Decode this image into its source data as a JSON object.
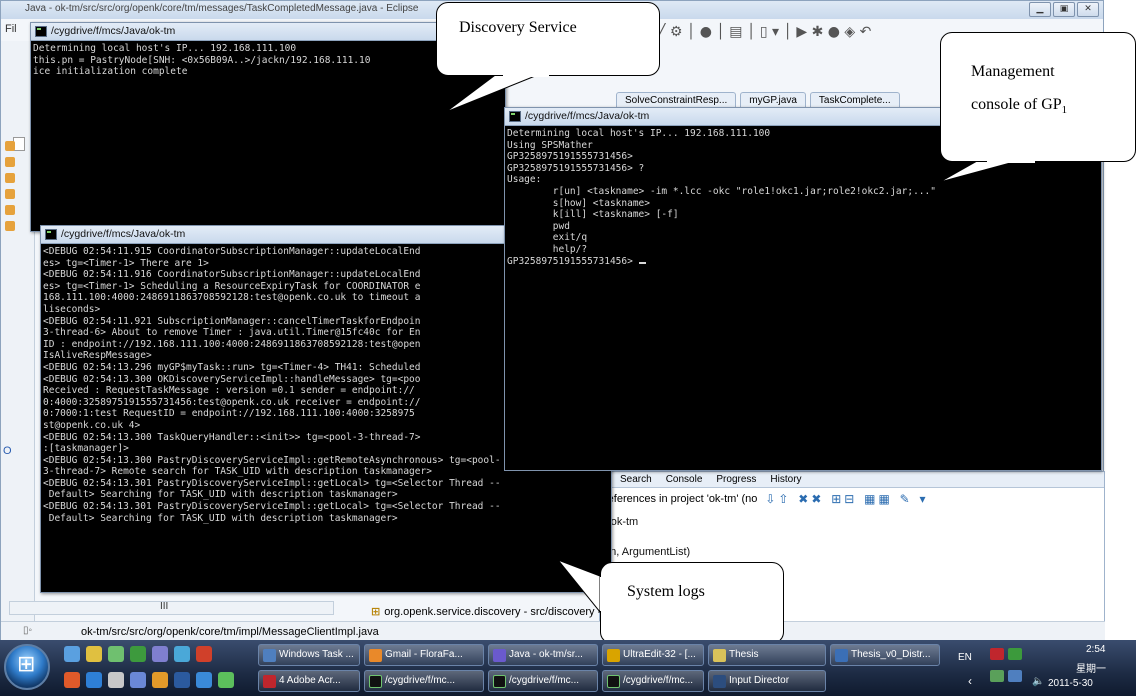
{
  "eclipse": {
    "title": "Java - ok-tm/src/src/org/openk/core/tm/messages/TaskCompletedMessage.java - Eclipse",
    "menu_file": "Fil",
    "editor_tabs": [
      "SolveConstraintResp...",
      "myGP.java",
      "TaskComplete..."
    ],
    "toolbar_glyphs": "╱ ⚙ │ ● │ ▤ │ ▯ ▾ │ ▶ ✱ ● ◈ ↶",
    "left_tab_o": "O",
    "left_hscroll_label": "III",
    "search_tabs": [
      "Search",
      "Console",
      "Progress",
      "History"
    ],
    "search_result_text": "references in project 'ok-tm' (no",
    "search_rows": [
      "- ok-tm",
      "an, ArgumentList)"
    ],
    "tree_items": [
      "org.openk.service.discovery - src/discovery - o"
    ],
    "status_path": "ok-tm/src/src/org/openk/core/tm/impl/MessageClientImpl.java",
    "status_icon": "▯◦"
  },
  "consoles": {
    "discovery": {
      "title": "/cygdrive/f/mcs/Java/ok-tm",
      "text": "Determining local host's IP... 192.168.111.100\nthis.pn = PastryNode[SNH: <0x56B09A..>/jackn/192.168.111.10\nice initialization complete"
    },
    "management": {
      "title": "/cygdrive/f/mcs/Java/ok-tm",
      "text": "Determining local host's IP... 192.168.111.100\nUsing SPSMather\nGP3258975191555731456>\nGP3258975191555731456> ?\nUsage:\n        r[un] <taskname> -im *.lcc -okc \"role1!okc1.jar;role2!okc2.jar;...\"\n        s[how] <taskname>\n        k[ill] <taskname> [-f]\n        pwd\n        exit/q\n        help/?",
      "prompt": "GP3258975191555731456> "
    },
    "logs": {
      "title": "/cygdrive/f/mcs/Java/ok-tm",
      "text": "<DEBUG 02:54:11.915 CoordinatorSubscriptionManager::updateLocalEnd\nes> tg=<Timer-1> There are 1>\n<DEBUG 02:54:11.916 CoordinatorSubscriptionManager::updateLocalEnd\nes> tg=<Timer-1> Scheduling a ResourceExpiryTask for COORDINATOR e\n168.111.100:4000:2486911863708592128:test@openk.co.uk to timeout a\nliseconds>\n<DEBUG 02:54:11.921 SubscriptionManager::cancelTimerTaskforEndpoin\n3-thread-6> About to remove Timer : java.util.Timer@15fc40c for En\nID : endpoint://192.168.111.100:4000:2486911863708592128:test@open\nIsAliveRespMessage>\n<DEBUG 02:54:13.296 myGP$myTask::run> tg=<Timer-4> TH41: Scheduled\n<DEBUG 02:54:13.300 OKDiscoveryServiceImpl::handleMessage> tg=<poo\nReceived : RequestTaskMessage : version =0.1 sender = endpoint://\n0:4000:3258975191555731456:test@openk.co.uk receiver = endpoint://\n0:7000:1:test RequestID = endpoint://192.168.111.100:4000:3258975\nst@openk.co.uk 4>\n<DEBUG 02:54:13.300 TaskQueryHandler::<init>> tg=<pool-3-thread-7>\n:[taskmanager]>\n<DEBUG 02:54:13.300 PastryDiscoveryServiceImpl::getRemoteAsynchronous> tg=<pool-\n3-thread-7> Remote search for TASK_UID with description taskmanager>\n<DEBUG 02:54:13.301 PastryDiscoveryServiceImpl::getLocal> tg=<Selector Thread --\n Default> Searching for TASK_UID with description taskmanager>\n<DEBUG 02:54:13.301 PastryDiscoveryServiceImpl::getLocal> tg=<Selector Thread --\n Default> Searching for TASK_UID with description taskmanager>"
    }
  },
  "callouts": {
    "discovery": "Discovery Service",
    "management_line1": "Management",
    "management_line2": "console of GP",
    "management_sub": "1",
    "logs": "System logs"
  },
  "taskbar": {
    "row1": [
      {
        "label": "Windows Task ...",
        "color": "#4f7fbf"
      },
      {
        "label": "Gmail - FloraFa...",
        "color": "#e9892a"
      },
      {
        "label": "Java - ok-tm/sr...",
        "color": "#6a5acd"
      },
      {
        "label": "UltraEdit-32 - [...",
        "color": "#d9a400"
      },
      {
        "label": "Thesis",
        "color": "#d9c25a"
      },
      {
        "label": "Thesis_v0_Distr...",
        "color": "#3b6fb6"
      }
    ],
    "row2": [
      {
        "label": "4 Adobe Acr...",
        "color": "#c0262d"
      },
      {
        "label": "/cygdrive/f/mc...",
        "color": "#111111"
      },
      {
        "label": "/cygdrive/f/mc...",
        "color": "#111111"
      },
      {
        "label": "/cygdrive/f/mc...",
        "color": "#111111"
      },
      {
        "label": "Input Director",
        "color": "#2c4d7e"
      }
    ],
    "tray": {
      "lang": "EN",
      "time": "2:54",
      "day": "星期一",
      "date": "2011-5-30"
    }
  }
}
